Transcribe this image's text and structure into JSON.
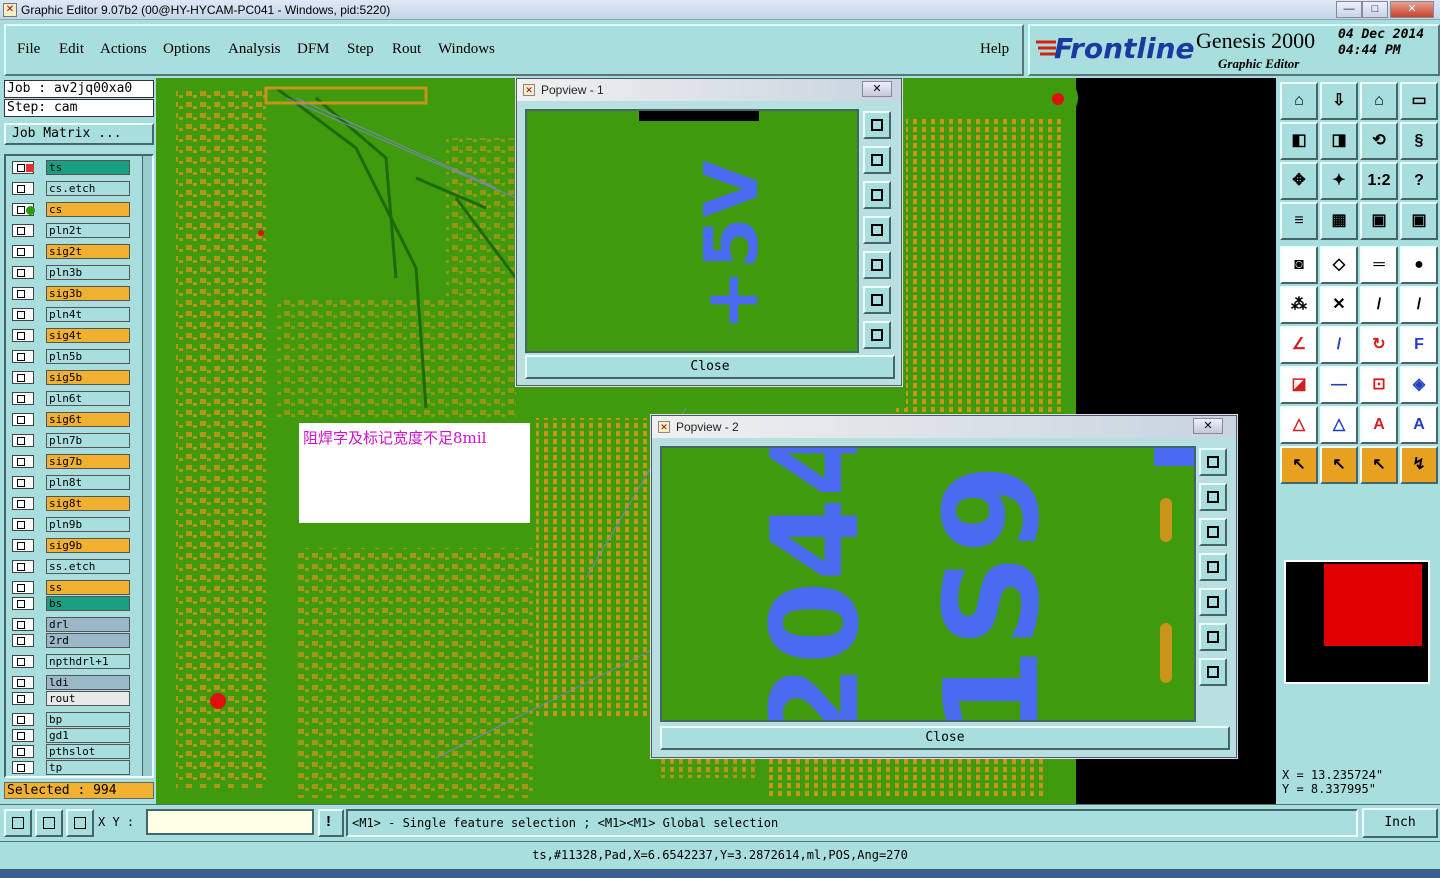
{
  "window": {
    "title": "Graphic Editor 9.07b2 (00@HY-HYCAM-PC041 - Windows, pid:5220)",
    "minimize": "—",
    "maximize": "□",
    "close": "✕"
  },
  "menu": [
    "File",
    "Edit",
    "Actions",
    "Options",
    "Analysis",
    "DFM",
    "Step",
    "Rout",
    "Windows"
  ],
  "help": "Help",
  "brand": {
    "logo": "Frontline",
    "product": "Genesis 2000",
    "subtitle": "Graphic Editor",
    "date": "04 Dec 2014",
    "time": "04:44 PM"
  },
  "job": {
    "job_label": "Job : av2jq00xa0",
    "step_label": "Step: cam",
    "matrix_button": "Job Matrix ..."
  },
  "layers": [
    {
      "name": "ts",
      "color": "#1aa080"
    },
    {
      "name": "cs.etch",
      "color": "#a9dede"
    },
    {
      "name": "cs",
      "color": "#f0b030"
    },
    {
      "name": "pln2t",
      "color": "#a9dede"
    },
    {
      "name": "sig2t",
      "color": "#f0b030"
    },
    {
      "name": "pln3b",
      "color": "#a9dede"
    },
    {
      "name": "sig3b",
      "color": "#f0b030"
    },
    {
      "name": "pln4t",
      "color": "#a9dede"
    },
    {
      "name": "sig4t",
      "color": "#f0b030"
    },
    {
      "name": "pln5b",
      "color": "#a9dede"
    },
    {
      "name": "sig5b",
      "color": "#f0b030"
    },
    {
      "name": "pln6t",
      "color": "#a9dede"
    },
    {
      "name": "sig6t",
      "color": "#f0b030"
    },
    {
      "name": "pln7b",
      "color": "#a9dede"
    },
    {
      "name": "sig7b",
      "color": "#f0b030"
    },
    {
      "name": "pln8t",
      "color": "#a9dede"
    },
    {
      "name": "sig8t",
      "color": "#f0b030"
    },
    {
      "name": "pln9b",
      "color": "#a9dede"
    },
    {
      "name": "sig9b",
      "color": "#f0b030"
    },
    {
      "name": "ss.etch",
      "color": "#a9dede"
    },
    {
      "name": "ss",
      "color": "#f0b030"
    },
    {
      "name": "bs",
      "color": "#1aa080"
    },
    {
      "name": "drl",
      "color": "#9ab8c8"
    },
    {
      "name": "2rd",
      "color": "#9ab8c8"
    },
    {
      "name": "npthdrl+1",
      "color": "#a9dede"
    },
    {
      "name": "ldi",
      "color": "#9ab8c8"
    },
    {
      "name": "rout",
      "color": "#e8e8e8"
    },
    {
      "name": "bp",
      "color": "#a9dede"
    },
    {
      "name": "gd1",
      "color": "#a9dede"
    },
    {
      "name": "pthslot",
      "color": "#a9dede"
    },
    {
      "name": "tp",
      "color": "#a9dede"
    }
  ],
  "selected": "Selected : 994",
  "annotation": "阻焊字及标记宽度不足8mil",
  "popview1": {
    "title": "Popview - 1",
    "close": "Close",
    "text": "+5V"
  },
  "popview2": {
    "title": "Popview - 2",
    "close": "Close",
    "text_row1": "2044",
    "text_row2": "1S9"
  },
  "coords": {
    "x": "X = 13.235724\"",
    "y": "Y = 8.337995\""
  },
  "status": {
    "xy_label": "X Y :",
    "xy_value": "",
    "message": "<M1> - Single feature selection ; <M1><M1> Global selection",
    "units": "Inch"
  },
  "info": "ts,#11328,Pad,X=6.6542237,Y=3.2872614,ml,POS,Ang=270",
  "colors": {
    "board": "#3f9a0e",
    "pad": "#c8941a",
    "silk": "#4a6af0",
    "panel": "#a9dede"
  }
}
